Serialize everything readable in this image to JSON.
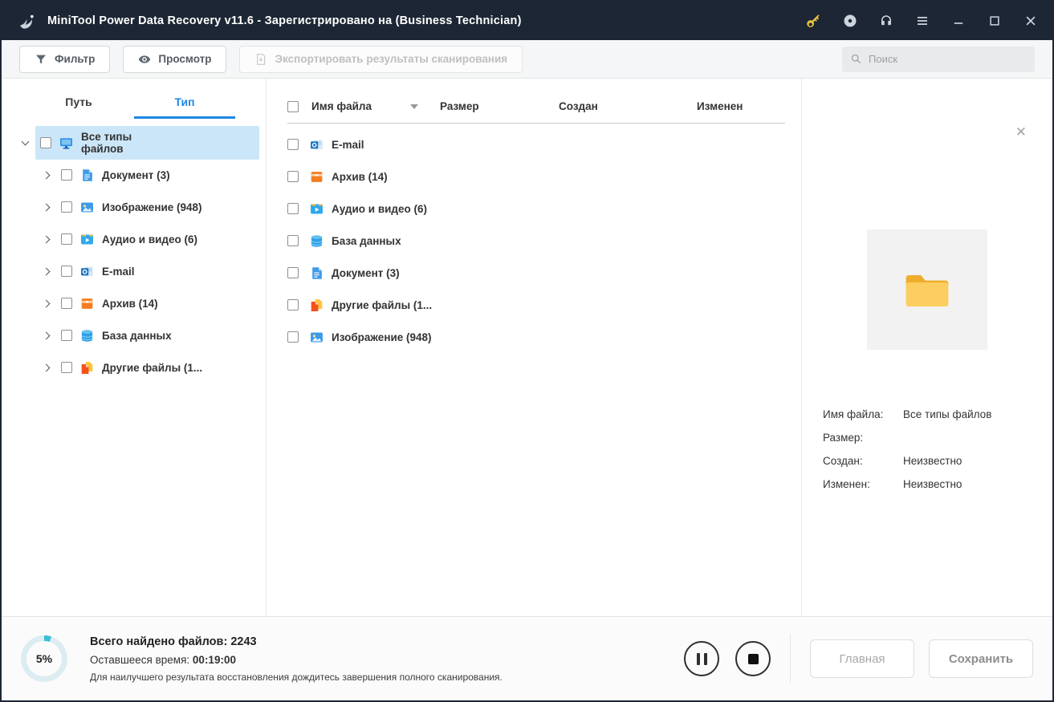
{
  "window": {
    "title": "MiniTool Power Data Recovery v11.6 - Зарегистрировано на (Business Technician)"
  },
  "toolbar": {
    "filter_label": "Фильтр",
    "preview_label": "Просмотр",
    "export_label": "Экспортировать результаты сканирования",
    "search_placeholder": "Поиск"
  },
  "tabs": [
    {
      "label": "Путь",
      "active": false
    },
    {
      "label": "Тип",
      "active": true
    }
  ],
  "tree": {
    "root": {
      "label": "Все типы файлов",
      "icon": "all-types-icon",
      "selected": true,
      "expanded": true
    },
    "items": [
      {
        "label": "Документ (3)",
        "icon": "document-icon"
      },
      {
        "label": "Изображение (948)",
        "icon": "image-icon"
      },
      {
        "label": "Аудио и видео (6)",
        "icon": "audio-video-icon"
      },
      {
        "label": "E-mail",
        "icon": "email-icon"
      },
      {
        "label": "Архив (14)",
        "icon": "archive-icon"
      },
      {
        "label": "База данных",
        "icon": "database-icon"
      },
      {
        "label": "Другие файлы (1...",
        "icon": "other-files-icon"
      }
    ]
  },
  "filelist": {
    "columns": {
      "name": "Имя файла",
      "size": "Размер",
      "created": "Создан",
      "modified": "Изменен"
    },
    "rows": [
      {
        "name": "E-mail",
        "icon": "email-icon"
      },
      {
        "name": "Архив (14)",
        "icon": "archive-icon"
      },
      {
        "name": "Аудио и видео (6)",
        "icon": "audio-video-icon"
      },
      {
        "name": "База данных",
        "icon": "database-icon"
      },
      {
        "name": "Документ (3)",
        "icon": "document-icon"
      },
      {
        "name": "Другие файлы (1...",
        "icon": "other-files-icon"
      },
      {
        "name": "Изображение (948)",
        "icon": "image-icon"
      }
    ]
  },
  "preview": {
    "thumbnail": "folder-icon",
    "fields": [
      {
        "label": "Имя файла:",
        "value": "Все типы файлов"
      },
      {
        "label": "Размер:",
        "value": ""
      },
      {
        "label": "Создан:",
        "value": "Неизвестно"
      },
      {
        "label": "Изменен:",
        "value": "Неизвестно"
      }
    ]
  },
  "statusbar": {
    "progress_percent": "5%",
    "found_label": "Всего найдено файлов:",
    "found_count": "2243",
    "time_label": "Оставшееся время:",
    "time_value": "00:19:00",
    "hint": "Для наилучшего результата восстановления дождитесь завершения полного сканирования.",
    "home_button": "Главная",
    "save_button": "Сохранить"
  },
  "colors": {
    "titlebar_bg": "#1d2634",
    "accent_blue": "#1e88e5",
    "selection_bg": "#cbe6f8",
    "progress_teal": "#39c0d4",
    "key_icon_color": "#e9c440"
  }
}
